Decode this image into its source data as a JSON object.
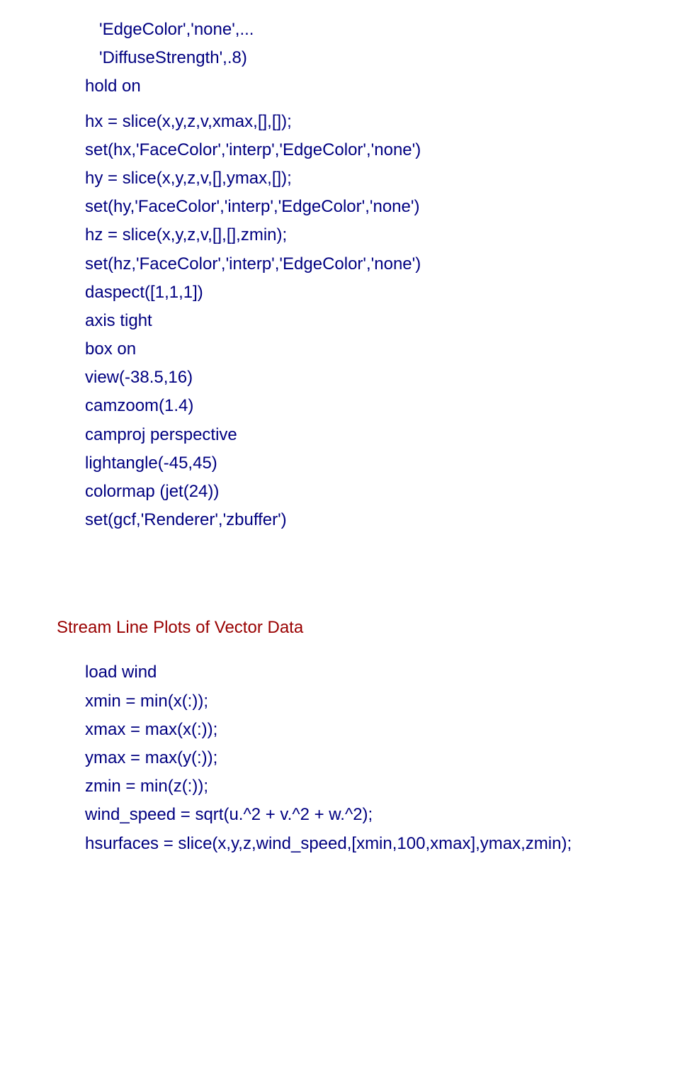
{
  "block1": {
    "lines": [
      "   'EdgeColor','none',...",
      "   'DiffuseStrength',.8)",
      "hold on",
      "hx = slice(x,y,z,v,xmax,[],[]);",
      "set(hx,'FaceColor','interp','EdgeColor','none')",
      "hy = slice(x,y,z,v,[],ymax,[]);",
      "set(hy,'FaceColor','interp','EdgeColor','none')",
      "hz = slice(x,y,z,v,[],[],zmin);",
      "set(hz,'FaceColor','interp','EdgeColor','none')",
      "daspect([1,1,1])",
      "axis tight",
      "box on",
      "view(-38.5,16)",
      "camzoom(1.4)",
      "camproj perspective",
      "lightangle(-45,45)",
      "colormap (jet(24))",
      "set(gcf,'Renderer','zbuffer')"
    ]
  },
  "heading": "Stream Line Plots of Vector Data",
  "block2": {
    "lines": [
      "load wind",
      "xmin = min(x(:));",
      "xmax = max(x(:));",
      "ymax = max(y(:));",
      "zmin = min(z(:));",
      "wind_speed = sqrt(u.^2 + v.^2 + w.^2);",
      "hsurfaces = slice(x,y,z,wind_speed,[xmin,100,xmax],ymax,zmin);"
    ]
  }
}
